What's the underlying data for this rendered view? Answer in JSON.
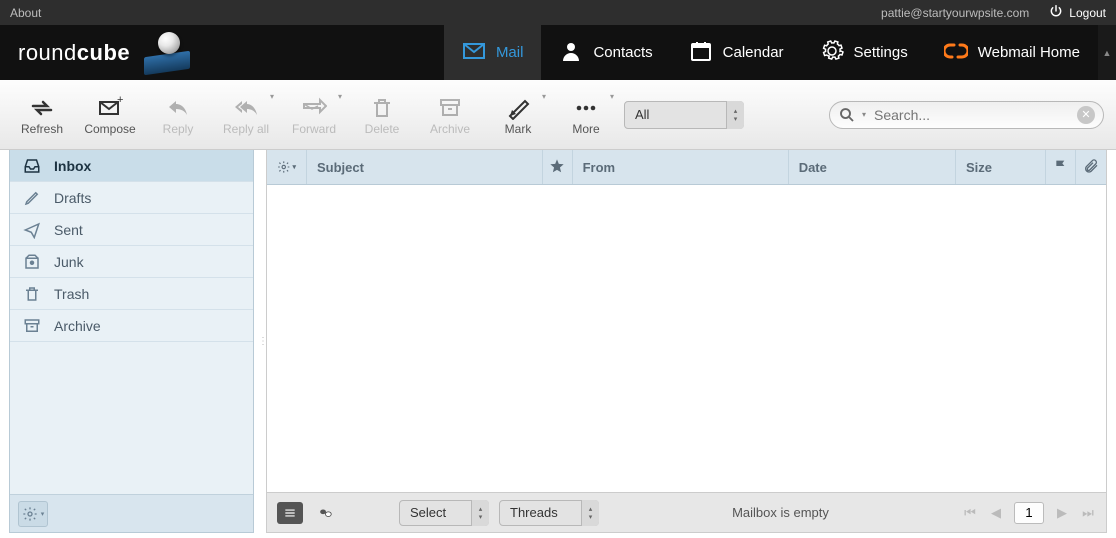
{
  "topbar": {
    "about": "About",
    "email": "pattie@startyourwpsite.com",
    "logout": "Logout"
  },
  "nav": {
    "logo": "roundcube",
    "items": [
      {
        "id": "mail",
        "label": "Mail",
        "active": true
      },
      {
        "id": "contacts",
        "label": "Contacts",
        "active": false
      },
      {
        "id": "calendar",
        "label": "Calendar",
        "active": false
      },
      {
        "id": "settings",
        "label": "Settings",
        "active": false
      },
      {
        "id": "webmail",
        "label": "Webmail Home",
        "active": false
      }
    ]
  },
  "toolbar": {
    "refresh": "Refresh",
    "compose": "Compose",
    "reply": "Reply",
    "replyall": "Reply all",
    "forward": "Forward",
    "delete": "Delete",
    "archive": "Archive",
    "mark": "Mark",
    "more": "More",
    "filter_value": "All",
    "search_placeholder": "Search..."
  },
  "folders": [
    {
      "id": "inbox",
      "label": "Inbox",
      "selected": true
    },
    {
      "id": "drafts",
      "label": "Drafts",
      "selected": false
    },
    {
      "id": "sent",
      "label": "Sent",
      "selected": false
    },
    {
      "id": "junk",
      "label": "Junk",
      "selected": false
    },
    {
      "id": "trash",
      "label": "Trash",
      "selected": false
    },
    {
      "id": "archive",
      "label": "Archive",
      "selected": false
    }
  ],
  "columns": {
    "subject": "Subject",
    "from": "From",
    "date": "Date",
    "size": "Size"
  },
  "status": {
    "select_label": "Select",
    "threads_label": "Threads",
    "empty": "Mailbox is empty",
    "page": "1"
  }
}
